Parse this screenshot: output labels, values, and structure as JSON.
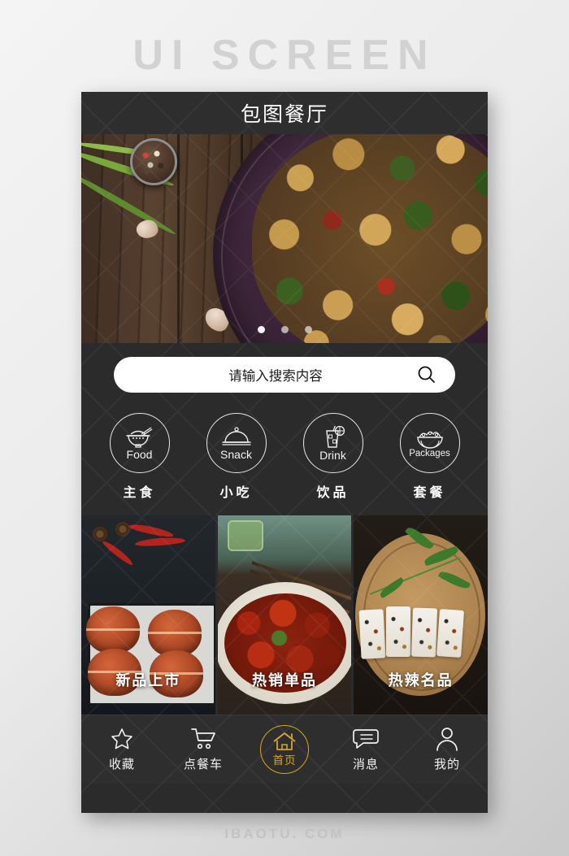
{
  "watermarks": {
    "top": "UI  SCREEN",
    "bottom": "IBAOTU. COM"
  },
  "header": {
    "title": "包图餐厅"
  },
  "hero": {
    "alt": "stir-fry chicken with broccoli on dark plate",
    "carousel": {
      "total": 3,
      "active_index": 0
    }
  },
  "search": {
    "placeholder": "请输入搜索内容",
    "value": "",
    "icon": "search-icon"
  },
  "categories": [
    {
      "en": "Food",
      "cn": "主食",
      "icon": "rice-bowl-icon"
    },
    {
      "en": "Snack",
      "cn": "小吃",
      "icon": "cloche-icon"
    },
    {
      "en": "Drink",
      "cn": "饮品",
      "icon": "drink-glass-icon"
    },
    {
      "en": "Packages",
      "cn": "套餐",
      "icon": "salad-bowl-icon"
    }
  ],
  "cards": [
    {
      "label": "新品上市",
      "alt": "steamed crabs with chili and star anise"
    },
    {
      "label": "热销单品",
      "alt": "spicy crayfish on white platter"
    },
    {
      "label": "热辣名品",
      "alt": "sliced dish on round wooden board"
    }
  ],
  "nav": [
    {
      "label": "收藏",
      "icon": "star-icon",
      "active": false
    },
    {
      "label": "点餐车",
      "icon": "cart-icon",
      "active": false
    },
    {
      "label": "首页",
      "icon": "home-icon",
      "active": true
    },
    {
      "label": "消息",
      "icon": "message-icon",
      "active": false
    },
    {
      "label": "我的",
      "icon": "person-icon",
      "active": false
    }
  ],
  "colors": {
    "panel_bg": "#2b2b2b",
    "header_bg": "#2e2e2e",
    "accent_gold": "#d8a520",
    "text_primary": "#ffffff",
    "page_bg": "#ececec"
  }
}
